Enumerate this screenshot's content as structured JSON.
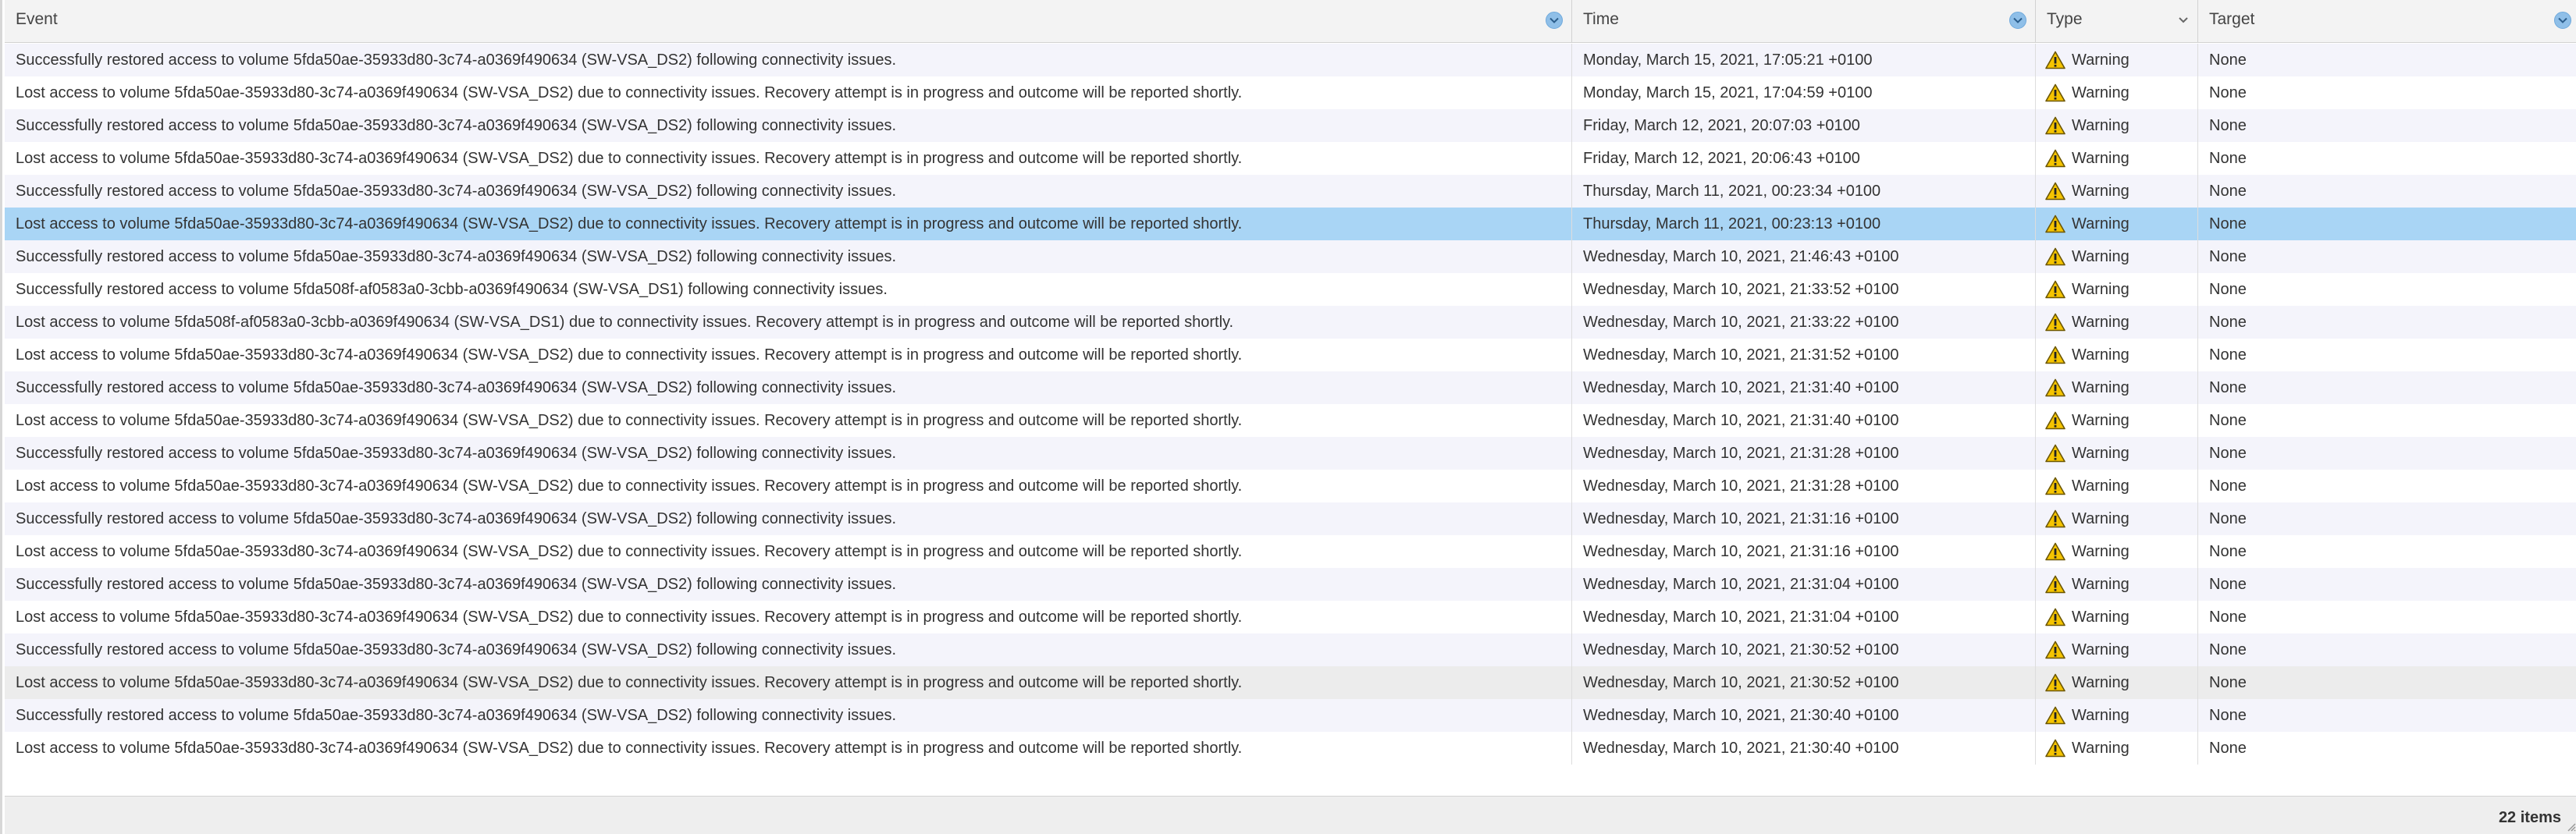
{
  "columns": {
    "event": "Event",
    "time": "Time",
    "type": "Type",
    "target": "Target"
  },
  "icons": {
    "sort": "sort-chevron-down-icon",
    "menu": "chevron-down-icon",
    "warning": "warning-icon"
  },
  "colors": {
    "selected_row": "#a9d5f5",
    "alt_row": "#f4f4fb",
    "sort_button": "#8fbfe8",
    "warning_fill": "#f5c400"
  },
  "selected_index": 5,
  "hover_index": 19,
  "rows": [
    {
      "event": "Successfully restored access to volume 5fda50ae-35933d80-3c74-a0369f490634 (SW-VSA_DS2) following connectivity issues.",
      "time": "Monday, March 15, 2021, 17:05:21 +0100",
      "type": "Warning",
      "target": "None"
    },
    {
      "event": "Lost access to volume 5fda50ae-35933d80-3c74-a0369f490634 (SW-VSA_DS2) due to connectivity issues. Recovery attempt is in progress and outcome will be reported shortly.",
      "time": "Monday, March 15, 2021, 17:04:59 +0100",
      "type": "Warning",
      "target": "None"
    },
    {
      "event": "Successfully restored access to volume 5fda50ae-35933d80-3c74-a0369f490634 (SW-VSA_DS2) following connectivity issues.",
      "time": "Friday, March 12, 2021, 20:07:03 +0100",
      "type": "Warning",
      "target": "None"
    },
    {
      "event": "Lost access to volume 5fda50ae-35933d80-3c74-a0369f490634 (SW-VSA_DS2) due to connectivity issues. Recovery attempt is in progress and outcome will be reported shortly.",
      "time": "Friday, March 12, 2021, 20:06:43 +0100",
      "type": "Warning",
      "target": "None"
    },
    {
      "event": "Successfully restored access to volume 5fda50ae-35933d80-3c74-a0369f490634 (SW-VSA_DS2) following connectivity issues.",
      "time": "Thursday, March 11, 2021, 00:23:34 +0100",
      "type": "Warning",
      "target": "None"
    },
    {
      "event": "Lost access to volume 5fda50ae-35933d80-3c74-a0369f490634 (SW-VSA_DS2) due to connectivity issues. Recovery attempt is in progress and outcome will be reported shortly.",
      "time": "Thursday, March 11, 2021, 00:23:13 +0100",
      "type": "Warning",
      "target": "None"
    },
    {
      "event": "Successfully restored access to volume 5fda50ae-35933d80-3c74-a0369f490634 (SW-VSA_DS2) following connectivity issues.",
      "time": "Wednesday, March 10, 2021, 21:46:43 +0100",
      "type": "Warning",
      "target": "None"
    },
    {
      "event": "Successfully restored access to volume 5fda508f-af0583a0-3cbb-a0369f490634 (SW-VSA_DS1) following connectivity issues.",
      "time": "Wednesday, March 10, 2021, 21:33:52 +0100",
      "type": "Warning",
      "target": "None"
    },
    {
      "event": "Lost access to volume 5fda508f-af0583a0-3cbb-a0369f490634 (SW-VSA_DS1) due to connectivity issues. Recovery attempt is in progress and outcome will be reported shortly.",
      "time": "Wednesday, March 10, 2021, 21:33:22 +0100",
      "type": "Warning",
      "target": "None"
    },
    {
      "event": "Lost access to volume 5fda50ae-35933d80-3c74-a0369f490634 (SW-VSA_DS2) due to connectivity issues. Recovery attempt is in progress and outcome will be reported shortly.",
      "time": "Wednesday, March 10, 2021, 21:31:52 +0100",
      "type": "Warning",
      "target": "None"
    },
    {
      "event": "Successfully restored access to volume 5fda50ae-35933d80-3c74-a0369f490634 (SW-VSA_DS2) following connectivity issues.",
      "time": "Wednesday, March 10, 2021, 21:31:40 +0100",
      "type": "Warning",
      "target": "None"
    },
    {
      "event": "Lost access to volume 5fda50ae-35933d80-3c74-a0369f490634 (SW-VSA_DS2) due to connectivity issues. Recovery attempt is in progress and outcome will be reported shortly.",
      "time": "Wednesday, March 10, 2021, 21:31:40 +0100",
      "type": "Warning",
      "target": "None"
    },
    {
      "event": "Successfully restored access to volume 5fda50ae-35933d80-3c74-a0369f490634 (SW-VSA_DS2) following connectivity issues.",
      "time": "Wednesday, March 10, 2021, 21:31:28 +0100",
      "type": "Warning",
      "target": "None"
    },
    {
      "event": "Lost access to volume 5fda50ae-35933d80-3c74-a0369f490634 (SW-VSA_DS2) due to connectivity issues. Recovery attempt is in progress and outcome will be reported shortly.",
      "time": "Wednesday, March 10, 2021, 21:31:28 +0100",
      "type": "Warning",
      "target": "None"
    },
    {
      "event": "Successfully restored access to volume 5fda50ae-35933d80-3c74-a0369f490634 (SW-VSA_DS2) following connectivity issues.",
      "time": "Wednesday, March 10, 2021, 21:31:16 +0100",
      "type": "Warning",
      "target": "None"
    },
    {
      "event": "Lost access to volume 5fda50ae-35933d80-3c74-a0369f490634 (SW-VSA_DS2) due to connectivity issues. Recovery attempt is in progress and outcome will be reported shortly.",
      "time": "Wednesday, March 10, 2021, 21:31:16 +0100",
      "type": "Warning",
      "target": "None"
    },
    {
      "event": "Successfully restored access to volume 5fda50ae-35933d80-3c74-a0369f490634 (SW-VSA_DS2) following connectivity issues.",
      "time": "Wednesday, March 10, 2021, 21:31:04 +0100",
      "type": "Warning",
      "target": "None"
    },
    {
      "event": "Lost access to volume 5fda50ae-35933d80-3c74-a0369f490634 (SW-VSA_DS2) due to connectivity issues. Recovery attempt is in progress and outcome will be reported shortly.",
      "time": "Wednesday, March 10, 2021, 21:31:04 +0100",
      "type": "Warning",
      "target": "None"
    },
    {
      "event": "Successfully restored access to volume 5fda50ae-35933d80-3c74-a0369f490634 (SW-VSA_DS2) following connectivity issues.",
      "time": "Wednesday, March 10, 2021, 21:30:52 +0100",
      "type": "Warning",
      "target": "None"
    },
    {
      "event": "Lost access to volume 5fda50ae-35933d80-3c74-a0369f490634 (SW-VSA_DS2) due to connectivity issues. Recovery attempt is in progress and outcome will be reported shortly.",
      "time": "Wednesday, March 10, 2021, 21:30:52 +0100",
      "type": "Warning",
      "target": "None"
    },
    {
      "event": "Successfully restored access to volume 5fda50ae-35933d80-3c74-a0369f490634 (SW-VSA_DS2) following connectivity issues.",
      "time": "Wednesday, March 10, 2021, 21:30:40 +0100",
      "type": "Warning",
      "target": "None"
    },
    {
      "event": "Lost access to volume 5fda50ae-35933d80-3c74-a0369f490634 (SW-VSA_DS2) due to connectivity issues. Recovery attempt is in progress and outcome will be reported shortly.",
      "time": "Wednesday, March 10, 2021, 21:30:40 +0100",
      "type": "Warning",
      "target": "None"
    }
  ],
  "footer": {
    "item_count": "22 items"
  }
}
